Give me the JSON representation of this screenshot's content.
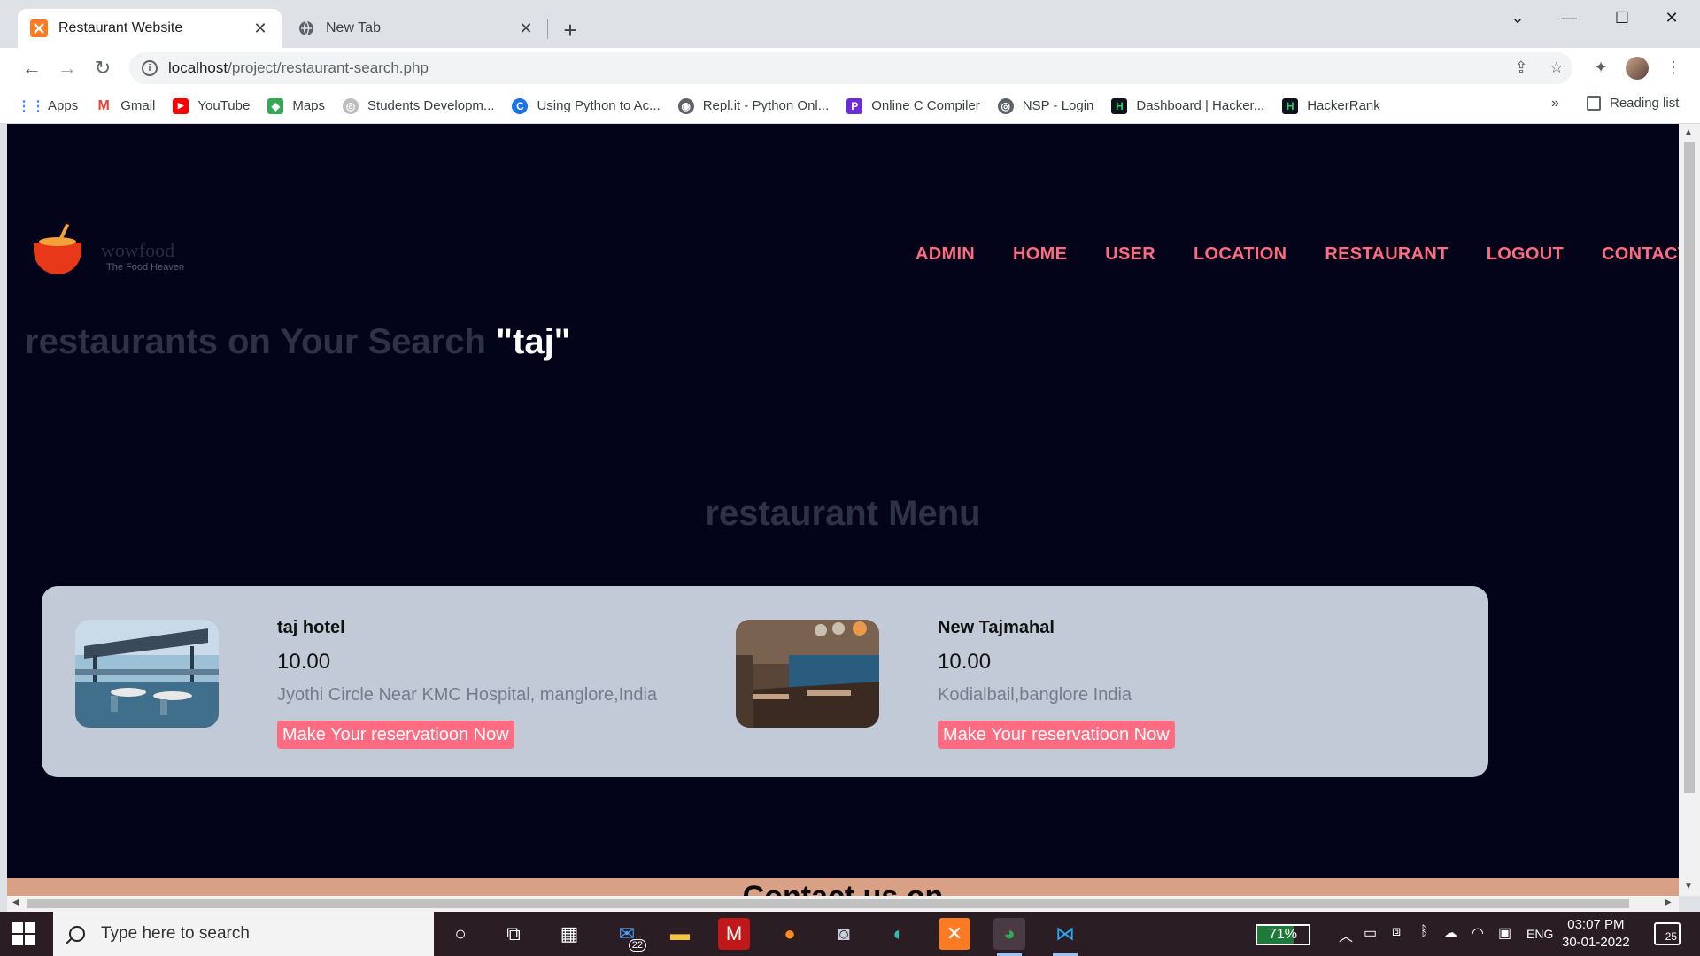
{
  "browser": {
    "tabs": [
      {
        "title": "Restaurant Website",
        "active": true
      },
      {
        "title": "New Tab",
        "active": false
      }
    ],
    "url_host": "localhost",
    "url_path": "/project/restaurant-search.php",
    "bookmarks": [
      {
        "label": "Apps",
        "icon": "apps-grid-icon",
        "color": "#4285f4"
      },
      {
        "label": "Gmail",
        "icon": "gmail-icon",
        "color": "#ea4335"
      },
      {
        "label": "YouTube",
        "icon": "youtube-icon",
        "color": "#ff0000"
      },
      {
        "label": "Maps",
        "icon": "maps-icon",
        "color": "#34a853"
      },
      {
        "label": "Students Developm...",
        "icon": "globe-icon",
        "color": "#9aa0a6"
      },
      {
        "label": "Using Python to Ac...",
        "icon": "c-logo-icon",
        "color": "#1a73e8"
      },
      {
        "label": "Repl.it - Python Onl...",
        "icon": "replit-icon",
        "color": "#5f6368"
      },
      {
        "label": "Online C Compiler",
        "icon": "compiler-icon",
        "color": "#6c2bd9"
      },
      {
        "label": "NSP - Login",
        "icon": "globe-icon",
        "color": "#5f6368"
      },
      {
        "label": "Dashboard | Hacker...",
        "icon": "hackerrank-icon",
        "color": "#0e141e"
      },
      {
        "label": "HackerRank",
        "icon": "hackerrank-icon",
        "color": "#0e141e"
      }
    ],
    "bookmarks_overflow": "»",
    "reading_list": "Reading list"
  },
  "page": {
    "logo": {
      "brand": "wowfood",
      "tagline": "The Food Heaven"
    },
    "nav": [
      "ADMIN",
      "HOME",
      "USER",
      "LOCATION",
      "RESTAURANT",
      "LOGOUT",
      "CONTACT"
    ],
    "search_heading_prefix": "restaurants on Your Search ",
    "search_term": "\"taj\"",
    "menu_heading": "restaurant Menu",
    "restaurants": [
      {
        "name": "taj hotel",
        "price": "10.00",
        "address": "Jyothi Circle Near KMC Hospital, manglore,India",
        "button": "Make Your reservatioon Now"
      },
      {
        "name": "New Tajmahal",
        "price": "10.00",
        "address": "Kodialbail,banglore India",
        "button": "Make Your reservatioon Now"
      }
    ],
    "contact_heading": "Contact us on",
    "colors": {
      "background": "#03031a",
      "accent": "#ff6b81",
      "card": "#c1cad6"
    }
  },
  "taskbar": {
    "search_placeholder": "Type here to search",
    "mail_badge": "22",
    "battery": "71%",
    "language": "ENG",
    "time": "03:07 PM",
    "date": "30-01-2022",
    "notifications": "25"
  }
}
